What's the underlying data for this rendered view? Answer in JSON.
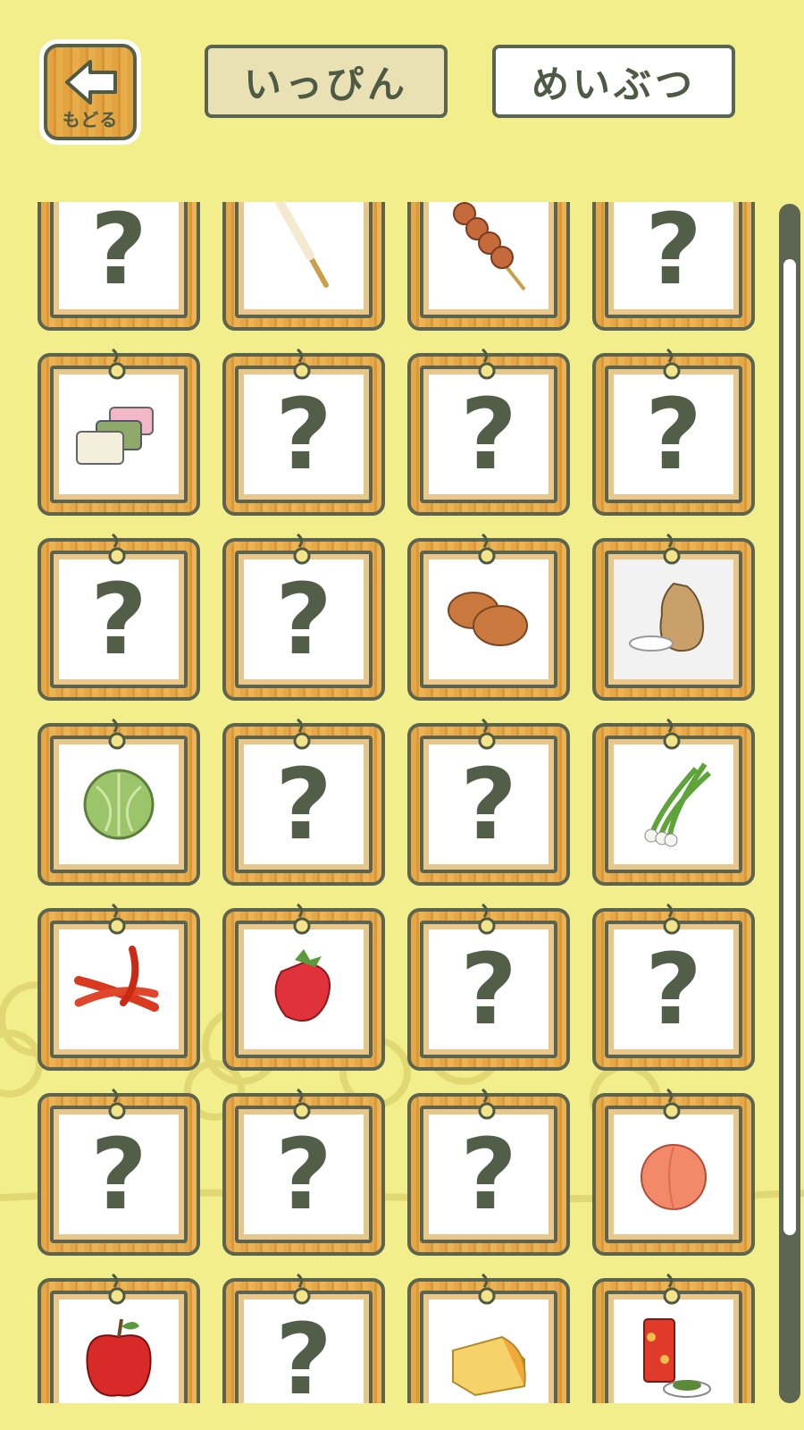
{
  "header": {
    "back_label": "もどる",
    "tabs": [
      {
        "label": "いっぴん",
        "active": true
      },
      {
        "label": "めいぶつ",
        "active": false
      }
    ]
  },
  "colors": {
    "background": "#f3ee8c",
    "wood": "#e6a846",
    "outline": "#55604a",
    "active_tab": "#e9e1b4"
  },
  "grid": {
    "columns": 4,
    "unknown_symbol": "?",
    "items": [
      {
        "kind": "unknown"
      },
      {
        "kind": "skewer-stick"
      },
      {
        "kind": "dango-skewer"
      },
      {
        "kind": "unknown"
      },
      {
        "kind": "mochi-blocks"
      },
      {
        "kind": "unknown"
      },
      {
        "kind": "unknown"
      },
      {
        "kind": "unknown"
      },
      {
        "kind": "unknown"
      },
      {
        "kind": "unknown"
      },
      {
        "kind": "manju-buns"
      },
      {
        "kind": "rice-sack"
      },
      {
        "kind": "cabbage"
      },
      {
        "kind": "unknown"
      },
      {
        "kind": "unknown"
      },
      {
        "kind": "green-onion"
      },
      {
        "kind": "chili-peppers"
      },
      {
        "kind": "strawberry"
      },
      {
        "kind": "unknown"
      },
      {
        "kind": "unknown"
      },
      {
        "kind": "unknown"
      },
      {
        "kind": "unknown"
      },
      {
        "kind": "unknown"
      },
      {
        "kind": "peach"
      },
      {
        "kind": "apple"
      },
      {
        "kind": "unknown"
      },
      {
        "kind": "cheese"
      },
      {
        "kind": "tea-can"
      }
    ]
  },
  "scroll": {
    "position": 0.02
  }
}
